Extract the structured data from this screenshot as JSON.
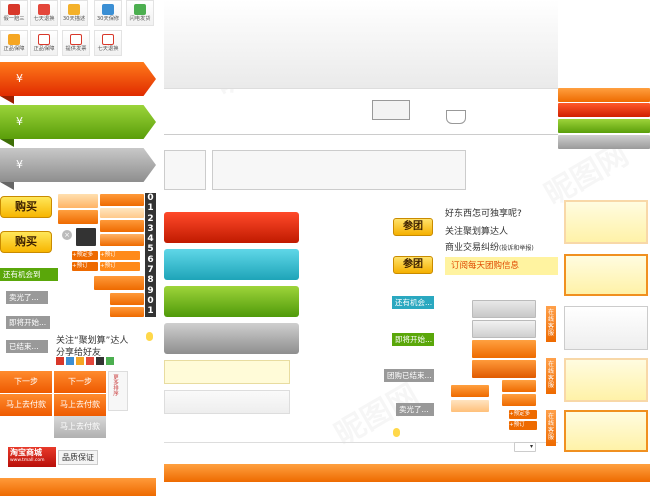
{
  "badges_row1": [
    "假一赔三",
    "七天退换",
    "30天描述",
    "30天保修",
    "闪电发货"
  ],
  "badges_row2": [
    "正品保障",
    "正品保障",
    "提供发票",
    "七天退换"
  ],
  "price_symbol": "¥",
  "buy_label": "购买",
  "tags": {
    "tag1": "+预定多",
    "tag2": "+预订"
  },
  "digits": [
    "0",
    "1",
    "2",
    "3",
    "4",
    "5",
    "6",
    "7",
    "8",
    "9",
    "0",
    "1"
  ],
  "status_texts": {
    "still_chance": "还有机会到",
    "sold_out": "卖光了...",
    "starting": "即将开始...",
    "ended": "已结束..."
  },
  "share": {
    "line1": "关注“聚划算”达人",
    "line2": "分享给好友"
  },
  "buttons": {
    "next": "下一步",
    "pay": "马上去付款",
    "pay2": "马上去付款",
    "pay3": "马上去付款",
    "sort": "更多排序"
  },
  "tmall": {
    "logo": "淘宝商城",
    "url": "www.tmall.com",
    "guarantee": "品质保证"
  },
  "right_col": {
    "question": "好东西怎可独享呢?",
    "join_label": "参团",
    "follow": "关注聚划算达人",
    "dispute": "商业交易纠纷",
    "dispute_note": "(投诉和举报)",
    "subscribe": "订阅每天团购信息",
    "still_chance": "还有机会...",
    "starting": "即将开始...",
    "ended": "团购已结束...",
    "sold_out": "卖光了..."
  },
  "side_tabs": [
    "在线客服",
    "在线客服",
    "在线客服"
  ],
  "watermark": "昵图网"
}
